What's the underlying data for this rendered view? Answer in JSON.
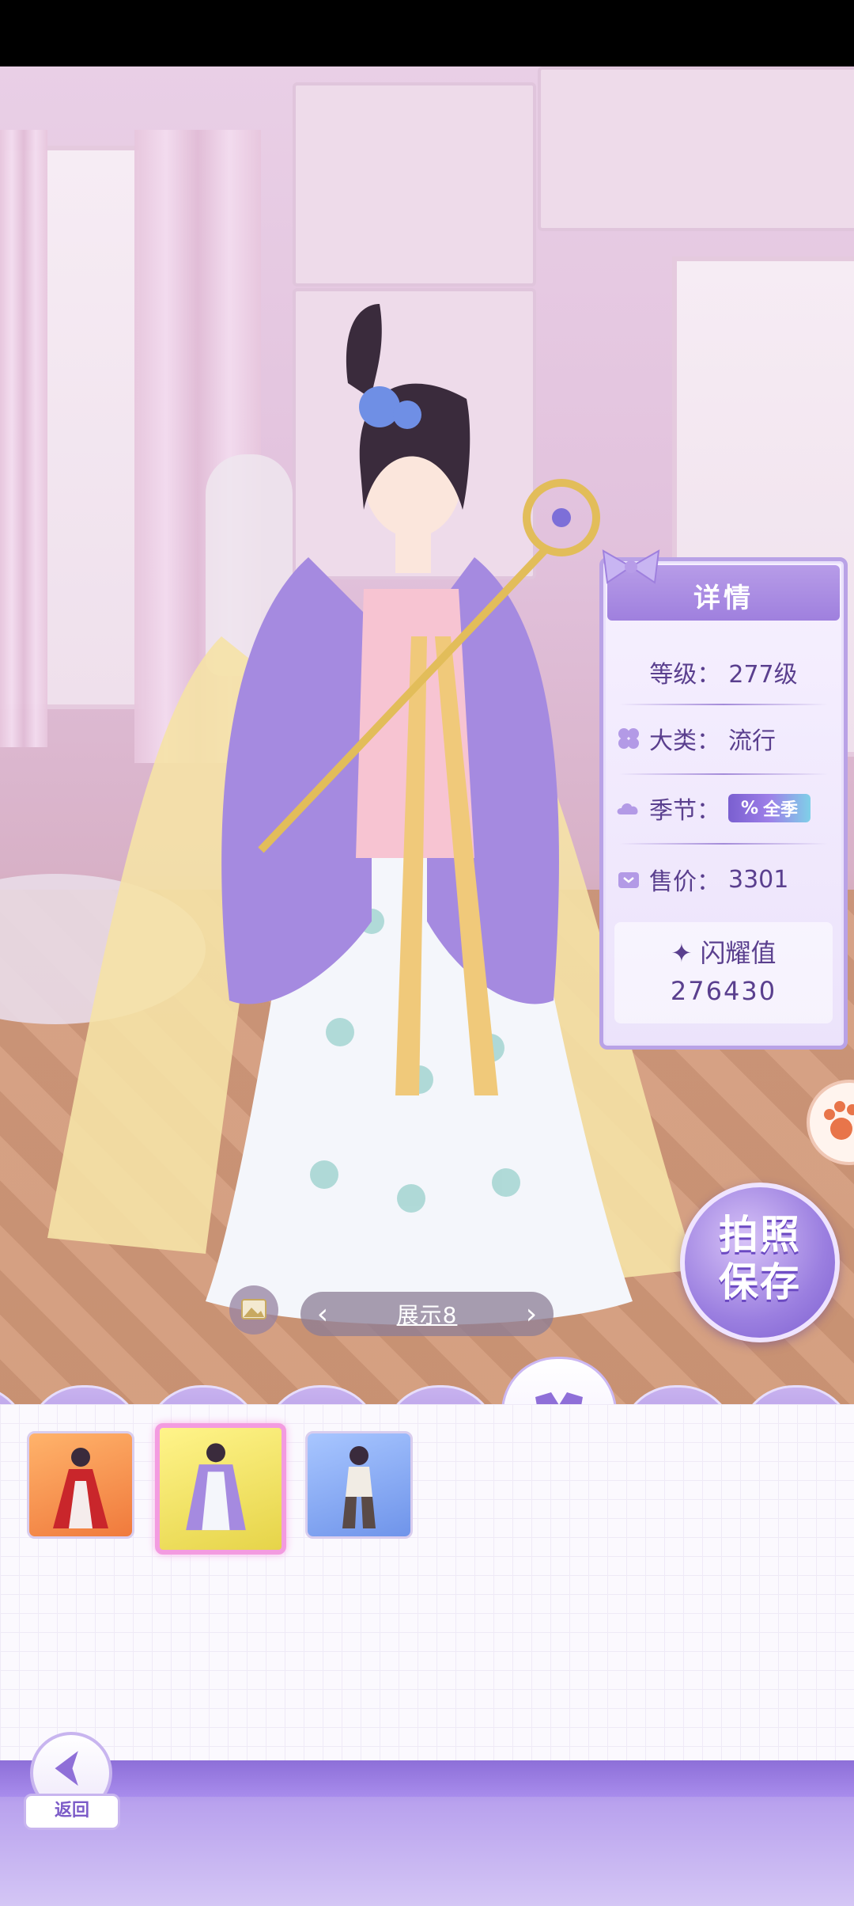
{
  "details": {
    "title": "详情",
    "level_label": "等级：",
    "level_value": "277级",
    "category_label": "大类：",
    "category_value": "流行",
    "season_label": "季节：",
    "season_value": "全季",
    "price_label": "售价：",
    "price_value": "3301",
    "shine_label": "闪耀值",
    "shine_value": "276430"
  },
  "photo_button": {
    "line1": "拍照",
    "line2": "保存"
  },
  "pager": {
    "label": "展示8",
    "prev": "‹",
    "next": "›"
  },
  "tabs": [
    {
      "name": "skirt",
      "icon": "skirt-icon"
    },
    {
      "name": "socks",
      "icon": "socks-icon"
    },
    {
      "name": "shoes",
      "icon": "high-heel-icon"
    },
    {
      "name": "mask",
      "icon": "mask-icon"
    },
    {
      "name": "suit",
      "icon": "robe-icon",
      "active": true
    },
    {
      "name": "bag",
      "icon": "handbag-icon"
    },
    {
      "name": "pet",
      "icon": "paw-icon"
    }
  ],
  "items": [
    {
      "color": "orange",
      "icon": "red-dress-outfit-icon"
    },
    {
      "color": "yellow",
      "icon": "purple-hanfu-outfit-icon",
      "selected": true
    },
    {
      "color": "blue",
      "icon": "warrior-outfit-icon"
    }
  ],
  "back_button": {
    "label": "返回"
  },
  "colors": {
    "accent": "#9b7fe0",
    "panel_border": "#b9a2e6",
    "selected_item": "#f39be0"
  }
}
